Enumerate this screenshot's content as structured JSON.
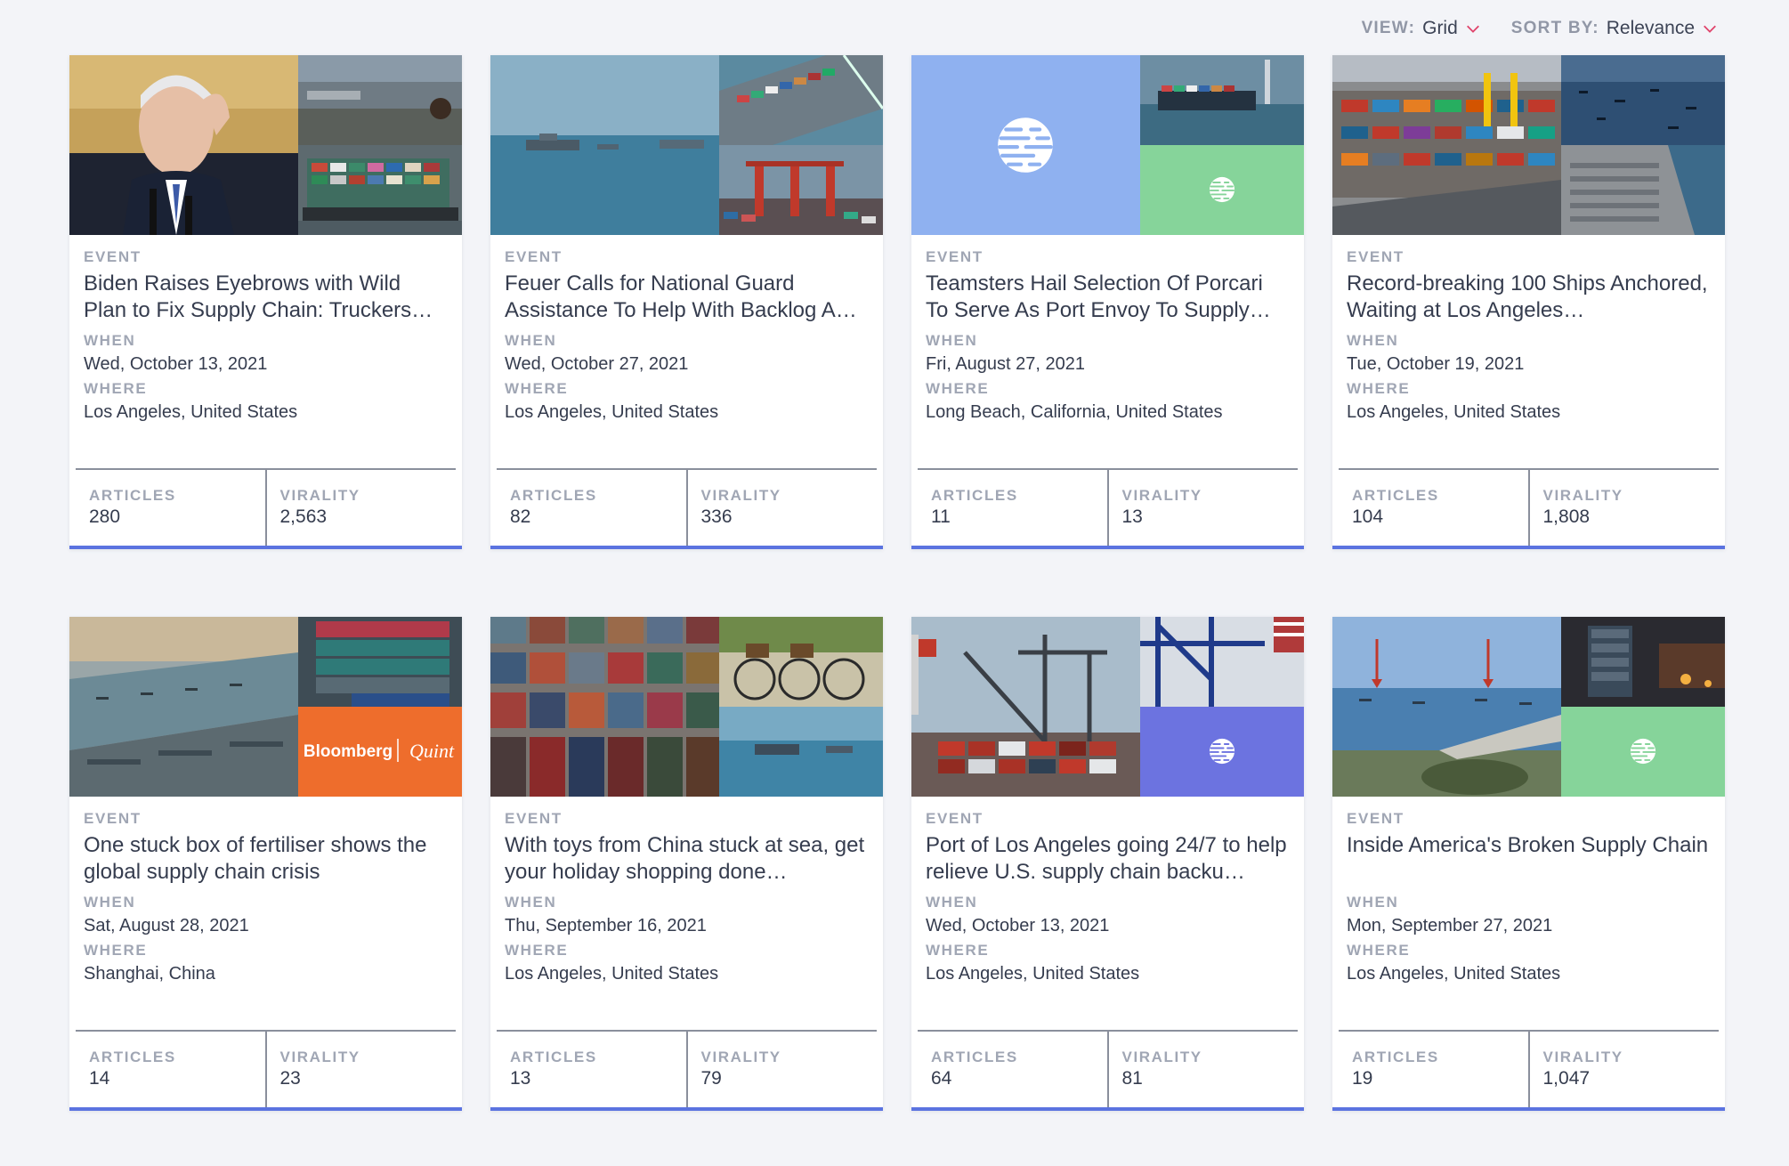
{
  "controls": {
    "view_label": "VIEW:",
    "view_value": "Grid",
    "sort_label": "SORT BY:",
    "sort_value": "Relevance",
    "chevron_icon": "chevron-down-icon",
    "chevron_color": "#e0436b"
  },
  "labels": {
    "event": "EVENT",
    "when": "WHEN",
    "where": "WHERE",
    "articles": "ARTICLES",
    "virality": "VIRALITY"
  },
  "accent": "#5b73e0",
  "cards": [
    {
      "title": "Biden Raises Eyebrows with Wild Plan to Fix Supply Chain: Truckers…",
      "when": "Wed, October 13, 2021",
      "where": "Los Angeles, United States",
      "articles": "280",
      "virality": "2,563"
    },
    {
      "title": "Feuer Calls for National Guard Assistance To Help With Backlog A…",
      "when": "Wed, October 27, 2021",
      "where": "Los Angeles, United States",
      "articles": "82",
      "virality": "336"
    },
    {
      "title": "Teamsters Hail Selection Of Porcari To Serve As Port Envoy To Supply…",
      "when": "Fri, August 27, 2021",
      "where": "Long Beach, California, United States",
      "articles": "11",
      "virality": "13"
    },
    {
      "title": "Record-breaking 100 Ships Anchored, Waiting at Los Angeles…",
      "when": "Tue, October 19, 2021",
      "where": "Los Angeles, United States",
      "articles": "104",
      "virality": "1,808"
    },
    {
      "title": "One stuck box of fertiliser shows the global supply chain crisis",
      "when": "Sat, August 28, 2021",
      "where": "Shanghai, China",
      "articles": "14",
      "virality": "23",
      "image_text": {
        "brand": "Bloomberg",
        "brand2": "Quint"
      }
    },
    {
      "title": "With toys from China stuck at sea, get your holiday shopping done…",
      "when": "Thu, September 16, 2021",
      "where": "Los Angeles, United States",
      "articles": "13",
      "virality": "79"
    },
    {
      "title": "Port of Los Angeles going 24/7 to help relieve U.S. supply chain backu…",
      "when": "Wed, October 13, 2021",
      "where": "Los Angeles, United States",
      "articles": "64",
      "virality": "81"
    },
    {
      "title": "Inside America's Broken Supply Chain",
      "when": "Mon, September 27, 2021",
      "where": "Los Angeles, United States",
      "articles": "19",
      "virality": "1,047"
    }
  ]
}
